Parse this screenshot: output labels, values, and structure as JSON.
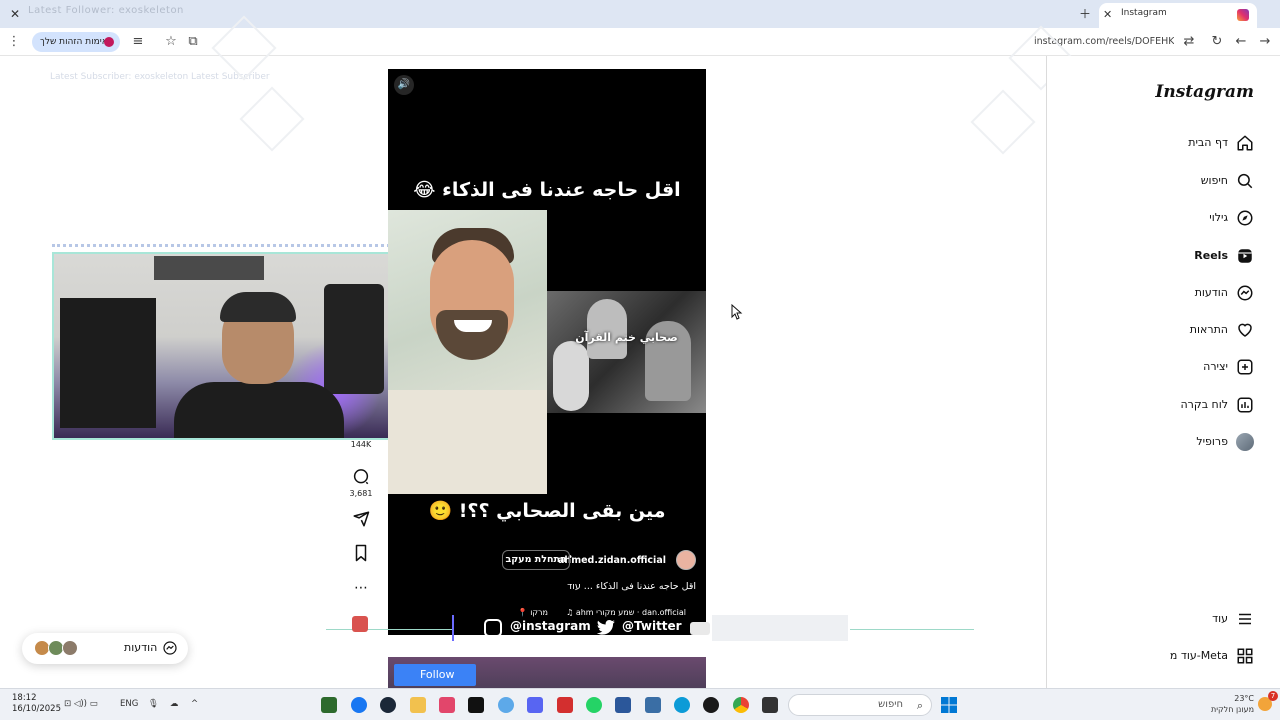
{
  "browser": {
    "ghost_tab_text": "Latest Follower: exoskeleton",
    "active_tab_title": "Instagram",
    "address": "instagram.com/reels/DOFEHKVj",
    "profile_label": "אימות הזהות שלך"
  },
  "overlay_text": {
    "stream_banner": "Latest Subscriber: exoskeleton Latest Subscriber"
  },
  "sidebar": {
    "logo": "Instagram",
    "items": [
      {
        "label": "דף הבית",
        "icon": "home-icon"
      },
      {
        "label": "חיפוש",
        "icon": "search-icon"
      },
      {
        "label": "גילוי",
        "icon": "explore-icon"
      },
      {
        "label": "Reels",
        "icon": "reels-icon"
      },
      {
        "label": "הודעות",
        "icon": "messenger-icon"
      },
      {
        "label": "התראות",
        "icon": "heart-icon"
      },
      {
        "label": "יצירה",
        "icon": "plus-square-icon"
      },
      {
        "label": "לוח בקרה",
        "icon": "dashboard-icon"
      },
      {
        "label": "פרופיל",
        "icon": "profile-avatar"
      }
    ],
    "more_label": "עוד",
    "meta_label": "עוד מ-Meta"
  },
  "reel": {
    "caption_top": "اقل حاجه عندنا فى الذكاء 😂",
    "caption_bottom": "مين بقى الصحابي ؟؟! 🙂",
    "inner_image_text": "صحابي ختم القرآن",
    "username": "ahmed.zidan.official",
    "follow_label": "התחלת מעקב",
    "description": "اقل حاجه عندنا فى الذكاء ... עוד",
    "audio_label": "♫ ahm  שמע מקורי · dan.official",
    "location_label": "📍 מרקו"
  },
  "actions": {
    "likes": "144K",
    "comments": "3,681"
  },
  "social": {
    "instagram": "@instagram",
    "twitter": "@Twitter"
  },
  "next_reel": {
    "follow": "Follow"
  },
  "messages_bubble": {
    "label": "הודעות"
  },
  "taskbar": {
    "time": "18:12",
    "date": "16/10/2025",
    "lang": "ENG",
    "search_label": "חיפוש",
    "weather_temp": "23°C",
    "weather_desc": "מעונן חלקית",
    "notif_count": "7"
  }
}
